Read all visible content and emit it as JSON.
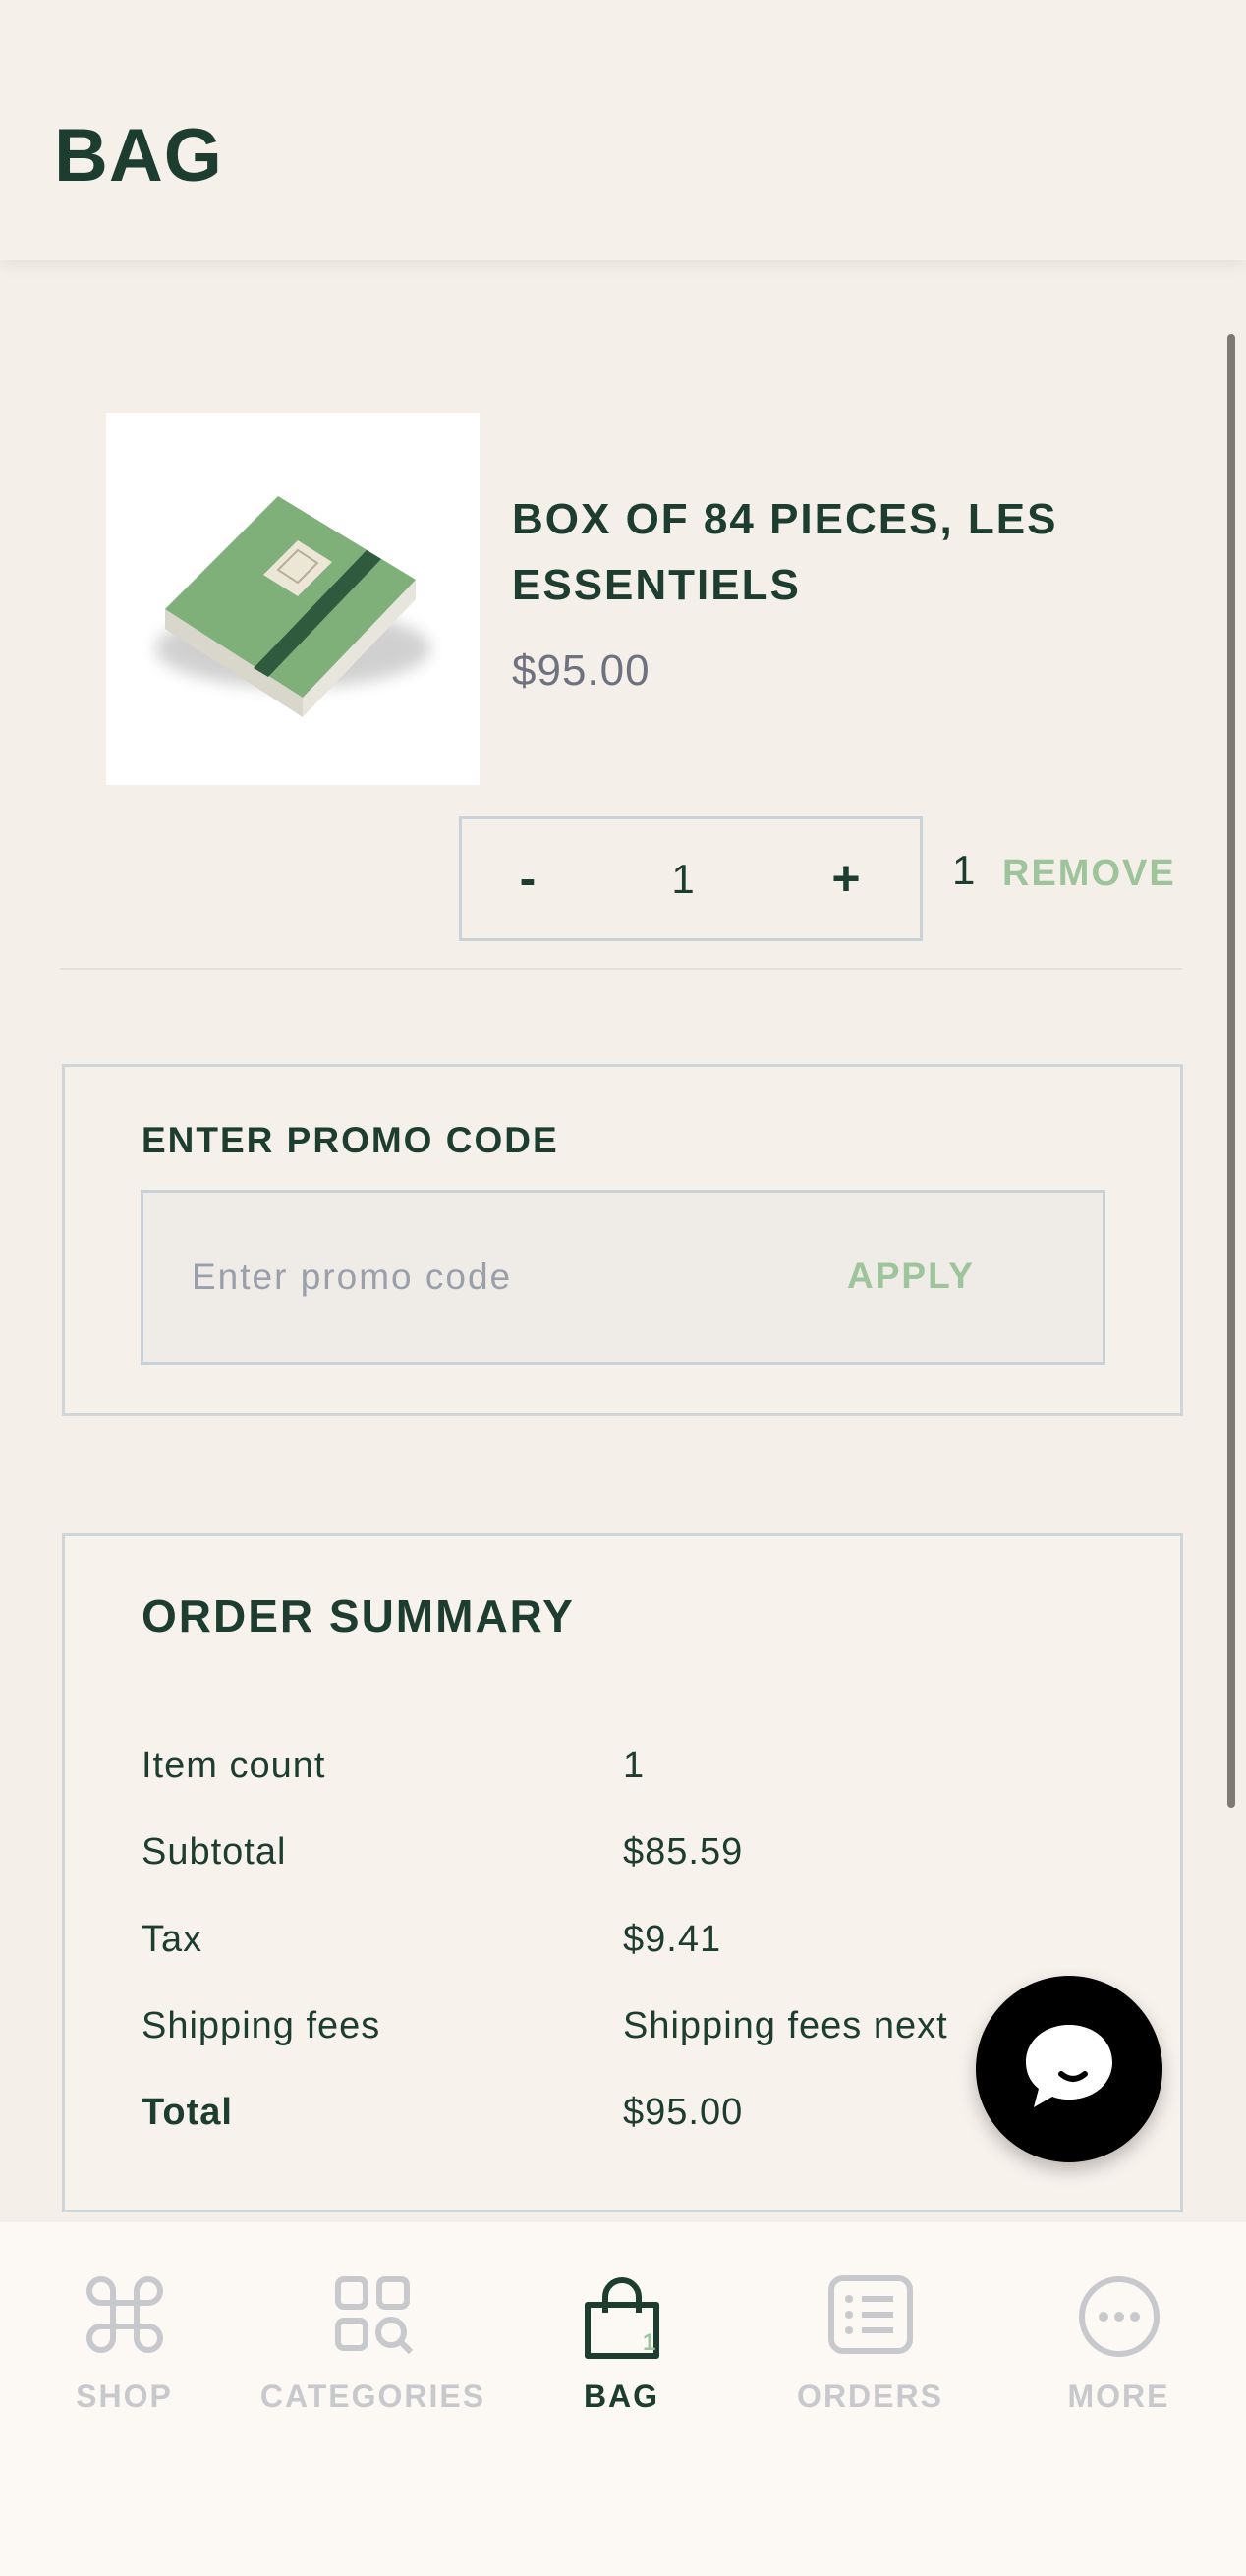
{
  "header": {
    "title": "BAG"
  },
  "cart": {
    "item": {
      "title": "BOX OF 84 PIECES, LES ESSENTIELS",
      "price": "$95.00",
      "quantity": "1",
      "count": "1",
      "minus_label": "-",
      "plus_label": "+",
      "remove_label": "REMOVE"
    }
  },
  "promo": {
    "title": "ENTER PROMO CODE",
    "placeholder": "Enter promo code",
    "value": "",
    "apply_label": "APPLY"
  },
  "summary": {
    "title": "ORDER SUMMARY",
    "rows": [
      {
        "label": "Item count",
        "value": "1"
      },
      {
        "label": "Subtotal",
        "value": "$85.59"
      },
      {
        "label": "Tax",
        "value": "$9.41"
      },
      {
        "label": "Shipping fees",
        "value": "Shipping fees next"
      },
      {
        "label": "Total",
        "value": "$95.00"
      }
    ]
  },
  "tabbar": {
    "tabs": [
      {
        "label": "SHOP",
        "icon": "command-icon"
      },
      {
        "label": "CATEGORIES",
        "icon": "categories-icon"
      },
      {
        "label": "BAG",
        "icon": "bag-icon",
        "badge": "1",
        "active": true
      },
      {
        "label": "ORDERS",
        "icon": "orders-icon"
      },
      {
        "label": "MORE",
        "icon": "more-icon"
      }
    ]
  },
  "colors": {
    "primary": "#1c3d2f",
    "accent_green": "#9dc49a",
    "background": "#f5efe9",
    "inactive": "#c7c9cc"
  }
}
